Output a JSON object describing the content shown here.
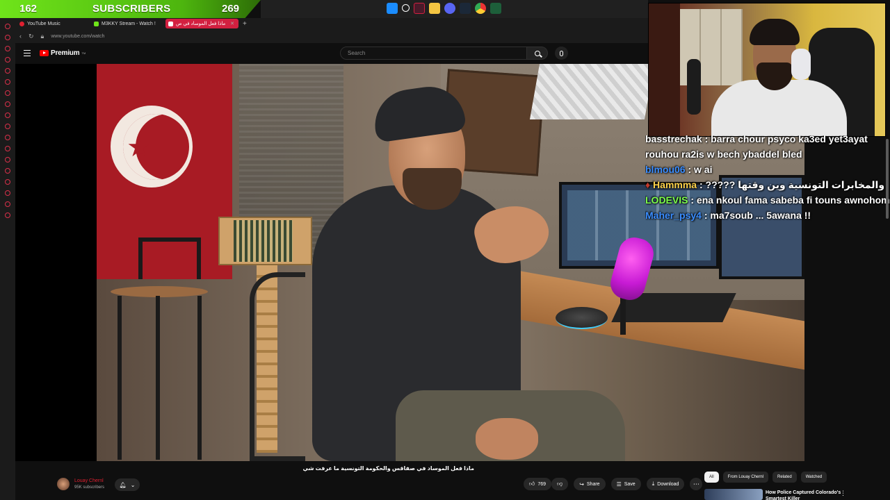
{
  "stream_overlay": {
    "subscriber_count_left": "162",
    "subscriber_label": "SUBSCRIBERS",
    "subscriber_count_right": "269",
    "accent_color": "#6fe41a"
  },
  "taskbar": {
    "icons": [
      "windows-icon",
      "search-icon",
      "app-icon",
      "folder-icon",
      "discord-icon",
      "steam-icon",
      "chrome-icon",
      "app-icon"
    ]
  },
  "browser": {
    "tabs": [
      {
        "label": "YouTube Music",
        "favicon_color": "#e02030"
      },
      {
        "label": "M3KKY Stream - Watch !",
        "favicon_color": "#6fe41a"
      },
      {
        "label": "ماذا فعل الموساد في ص",
        "favicon_color": "#ffffff",
        "active": true
      }
    ],
    "url": "www.youtube.com/watch",
    "accent_color": "#d32040"
  },
  "youtube_header": {
    "logo_text": "Premium",
    "logo_sup": "TM",
    "search_placeholder": "Search"
  },
  "chat": {
    "messages": [
      {
        "user": "basstrechak",
        "user_color": "#ffffff",
        "text": " : barra chour psyco ka3ed yet3ayat rouhou ra2is w bech ybaddel bled"
      },
      {
        "user": "blmou06",
        "user_color": "#3a8dff",
        "text": " : w ai"
      },
      {
        "user": "Hammma",
        "user_color": "#ffd24a",
        "text": " : ????? والمخابرات التونسية وين وقتها"
      },
      {
        "user": "LODEVIS",
        "user_color": "#7cff4a",
        "text": " : ena nkoul fama sabeba fi touns awnohom"
      },
      {
        "user": "Maher_psy4",
        "user_color": "#3a8dff",
        "text": " : ma7soub ... 5awana !!"
      }
    ]
  },
  "video": {
    "title": "ماذا فعل الموساد في صفاقس والحكومة التونسية ما عرفت شي",
    "channel_name": "Louay Chernl",
    "channel_subs": "95K subscribers",
    "like_count": "769",
    "share_label": "Share",
    "save_label": "Save",
    "download_label": "Download"
  },
  "sidebar_right": {
    "chips": [
      "All",
      "From Louay Chernl",
      "Related",
      "Watched"
    ],
    "recommendation_title": "How Police Captured Colorado's Smartest Killer"
  }
}
